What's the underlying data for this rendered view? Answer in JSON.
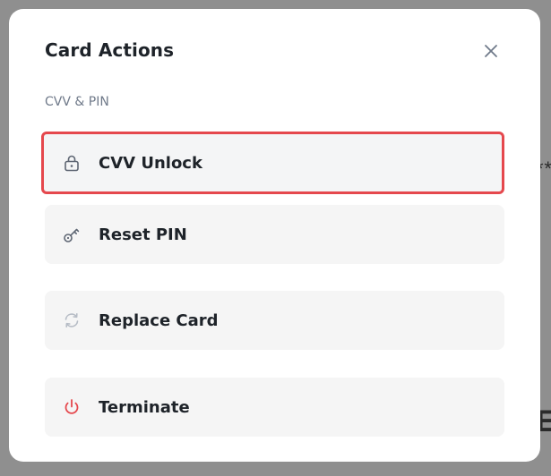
{
  "modal": {
    "title": "Card Actions",
    "section_label": "CVV & PIN"
  },
  "actions": [
    {
      "label": "CVV Unlock",
      "icon": "lock-icon",
      "highlighted": true,
      "highlight_color": "#e5484d"
    },
    {
      "label": "Reset PIN",
      "icon": "key-icon"
    },
    {
      "label": "Replace Card",
      "icon": "refresh-icon"
    },
    {
      "label": "Terminate",
      "icon": "power-icon",
      "icon_color": "#e5484d"
    }
  ],
  "background": {
    "fragment_text": "**",
    "fragment_letter": "E"
  }
}
